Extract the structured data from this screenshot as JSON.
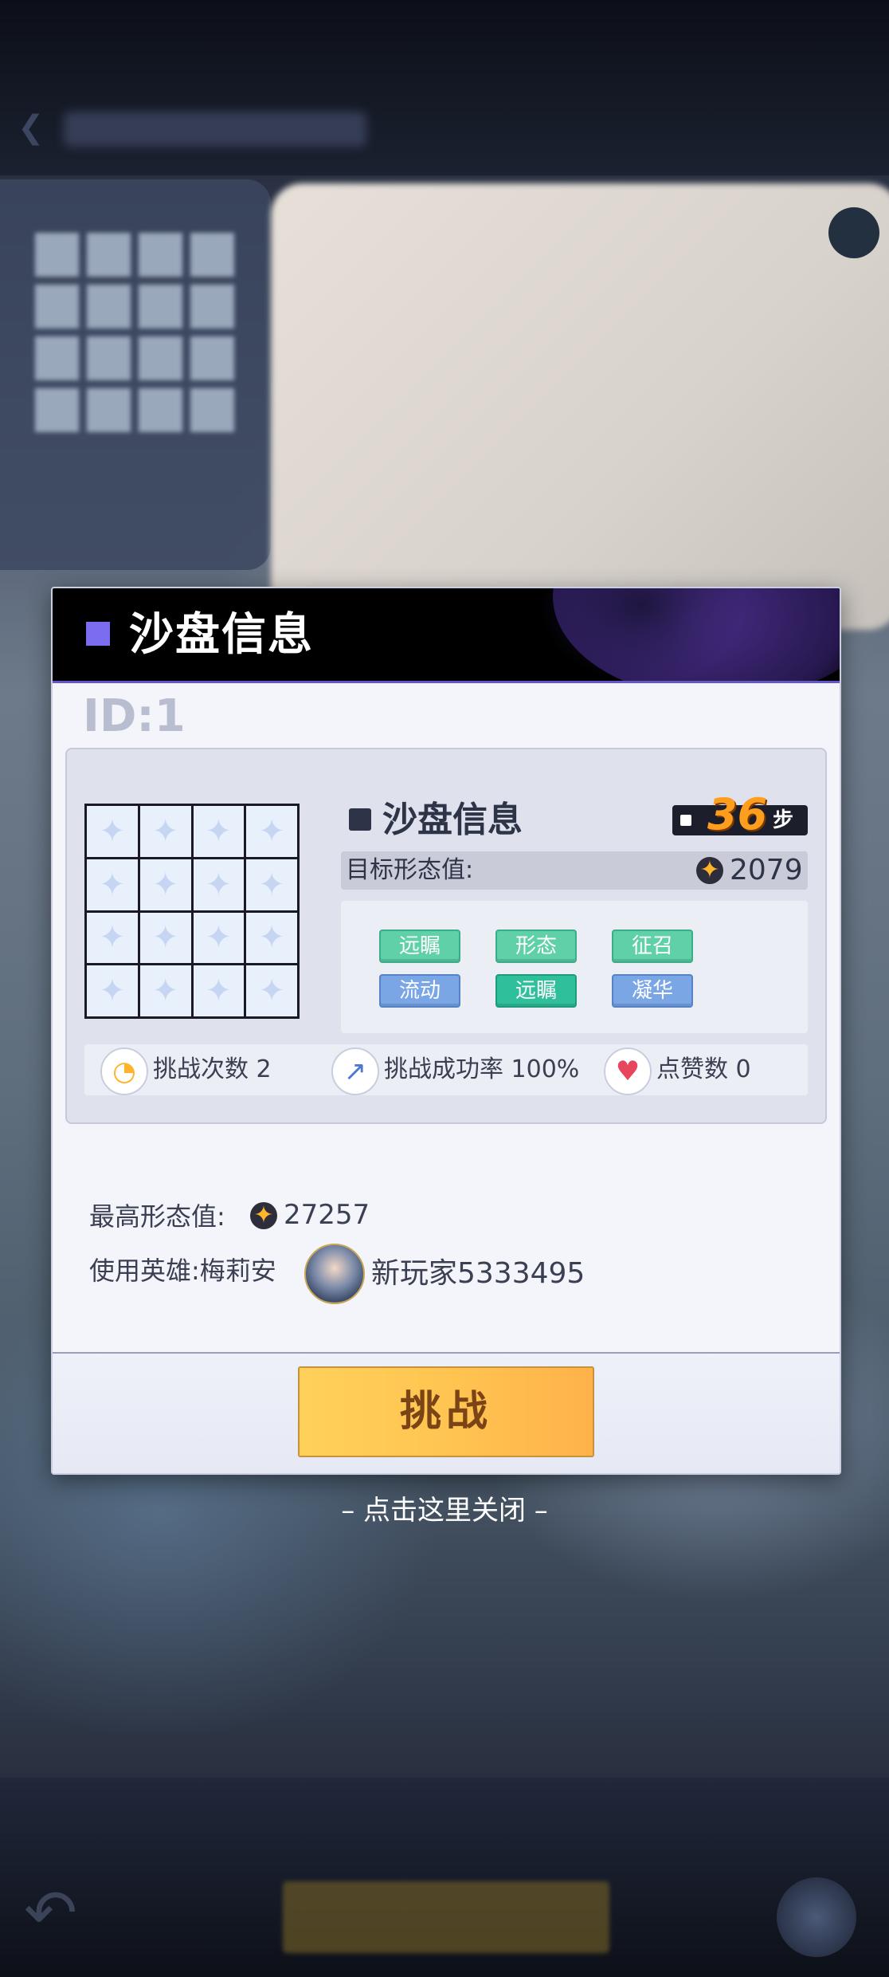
{
  "dialog": {
    "title": "沙盘信息",
    "id_label": "ID:1",
    "card": {
      "title": "沙盘信息",
      "steps_value": "36",
      "steps_unit": "步",
      "target_label": "目标形态值:",
      "target_value": "2079",
      "tags": [
        "远瞩",
        "形态",
        "征召",
        "流动",
        "远瞩",
        "凝华"
      ],
      "stats": {
        "attempts": "挑战次数 2",
        "success_rate": "挑战成功率 100%",
        "likes": "点赞数 0"
      }
    },
    "record": {
      "best_label": "最高形态值:",
      "best_value": "27257",
      "hero_label": "使用英雄:梅莉安",
      "player_name": "新玩家5333495"
    },
    "challenge_button": "挑战"
  },
  "close_hint": "– 点击这里关闭 –",
  "icons": {
    "steps": "square-dot-icon",
    "coin": "star-coin-icon",
    "attempts": "clock-icon",
    "success_rate": "arrow-up-icon",
    "likes": "heart-icon"
  },
  "colors": {
    "accent": "#7b6cf0",
    "button": "#ffc350",
    "tag_green": "#5fd0a8",
    "tag_teal": "#2fbf9a",
    "tag_blue": "#7aa6e6"
  }
}
